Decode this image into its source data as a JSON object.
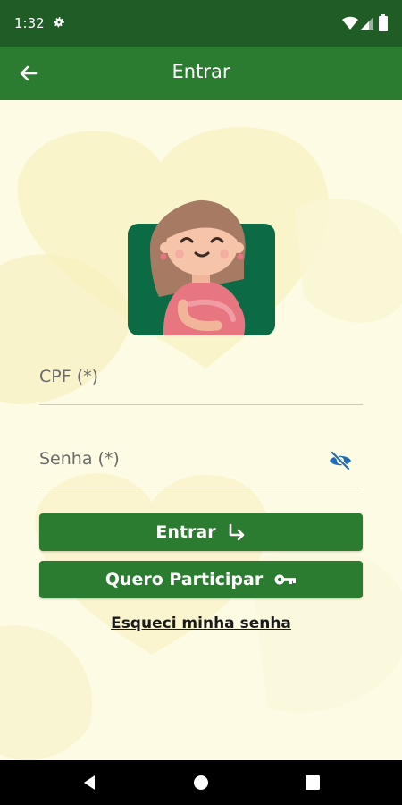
{
  "status_bar": {
    "time": "1:32",
    "icons": [
      "gear-icon",
      "wifi-icon",
      "signal-icon",
      "battery-icon"
    ]
  },
  "app_bar": {
    "title": "Entrar",
    "back_icon": "arrow-left-icon"
  },
  "form": {
    "cpf_label": "CPF (*)",
    "password_label": "Senha (*)",
    "password_toggle_icon": "eye-off-icon"
  },
  "buttons": {
    "login_label": "Entrar",
    "login_icon": "arrow-enter-icon",
    "participate_label": "Quero Participar",
    "participate_icon": "key-icon"
  },
  "forgot_password_label": "Esqueci minha senha",
  "nav_bar": {
    "icons": [
      "back-triangle-icon",
      "home-circle-icon",
      "recents-square-icon"
    ]
  },
  "colors": {
    "primary": "#2b7b30",
    "status_bar": "#1f5c26",
    "background": "#fdfbe3",
    "accent_icon": "#1e6fb8"
  }
}
